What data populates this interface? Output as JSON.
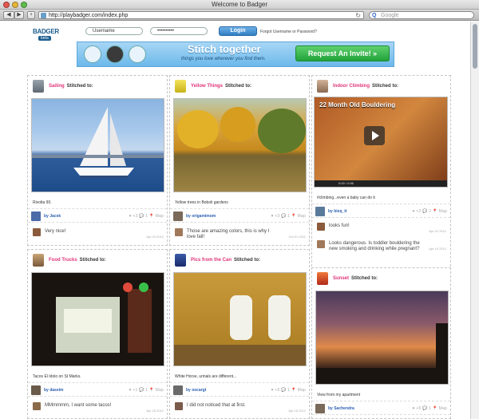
{
  "window": {
    "title": "Welcome to Badger"
  },
  "browser": {
    "back": "◀",
    "forward": "▶",
    "add": "+",
    "url": "http://playbadger.com/index.php",
    "search_placeholder": "Google"
  },
  "header": {
    "logo": "BADGER",
    "beta": "beta",
    "username_value": "Username",
    "password_value": "••••••••••",
    "login_label": "Login",
    "forgot_label": "Forgot Username or Password?"
  },
  "banner": {
    "headline": "Stitch together",
    "subline": "things you love wherever you find them.",
    "cta_label": "Request An Invite! »"
  },
  "cards": [
    {
      "tag": "Sailing",
      "stitched": "Stitched to:",
      "caption": "Rivolta 90.",
      "author": "by Jacek",
      "stats": "♥ +3  💬 1  📍 Map",
      "comments": [
        {
          "text": "Very nice!",
          "date": "Apr 03 2012"
        }
      ]
    },
    {
      "tag": "Yellow Things",
      "stitched": "Stitched to:",
      "caption": "Yellow trees in Boboli gardens",
      "author": "by origamimom",
      "stats": "♥ +3  💬 1  📍 Map",
      "comments": [
        {
          "text": "Those are amazing colors, this is why I love fall!",
          "date": "Oct 31 2011"
        }
      ]
    },
    {
      "tag": "Indoor Climbing",
      "stitched": "Stitched to:",
      "video_title": "22 Month Old Bouldering",
      "video_time": "0:00 / 0:56",
      "caption": "#climbing...even a baby can do it",
      "author": "by bisq_it",
      "stats": "♥ +2  💬 2  📍 Map",
      "comments": [
        {
          "text": "looks fun!",
          "date": "Apr 02 2012"
        },
        {
          "text": "Looks dangerous. Is toddler bouldering the new smoking and drinking while pregnant?",
          "date": "Apr 10 2012"
        }
      ]
    },
    {
      "tag": "Food Trucks",
      "stitched": "Stitched to:",
      "caption": "Tacos El Idolo on St Marks.",
      "author": "by daseim",
      "stats": "♥ +1  💬 1  📍 Map",
      "comments": [
        {
          "text": "MMmmmm, I want some tacos!",
          "date": "Apr 18 2012"
        }
      ]
    },
    {
      "tag": "Pics from the Can",
      "stitched": "Stitched to:",
      "caption": "White Horse, urinals are different...",
      "author": "by oscargt",
      "stats": "♥ +5  💬 1  📍 Map",
      "comments": [
        {
          "text": "I did not noticed that at first.",
          "date": "Apr 18 2012"
        }
      ]
    },
    {
      "tag": "Sunset",
      "stitched": "Stitched to:",
      "caption": "View from my apartment",
      "author": "by Sachendra",
      "stats": "♥ +5  💬 1  📍 Map",
      "comments": []
    }
  ],
  "colors": {
    "tag": "#e0337a",
    "author": "#2b5fb0",
    "cta": "#21a23a",
    "banner": "#6cb9ea"
  }
}
